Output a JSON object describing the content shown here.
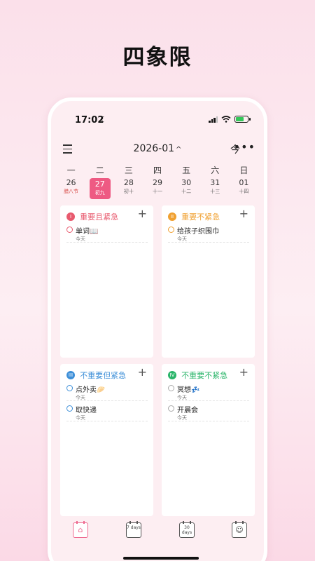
{
  "promo": {
    "title": "四象限"
  },
  "status_bar": {
    "time": "17:02",
    "moon": "☾"
  },
  "colors": {
    "accent": "#ee5a83",
    "q1": "#e85a6e",
    "q2": "#f0a030",
    "q3": "#3d8fd8",
    "q4": "#2bb56a"
  },
  "header": {
    "month": "2026-01",
    "month_chevron": "^",
    "today_label": "今",
    "more_label": "•••"
  },
  "week": {
    "weekdays": [
      "一",
      "二",
      "三",
      "四",
      "五",
      "六",
      "日"
    ],
    "dates": [
      {
        "day": "26",
        "lunar": "腊八节"
      },
      {
        "day": "27",
        "lunar": "初九",
        "selected": true
      },
      {
        "day": "28",
        "lunar": "初十"
      },
      {
        "day": "29",
        "lunar": "十一"
      },
      {
        "day": "30",
        "lunar": "十二"
      },
      {
        "day": "31",
        "lunar": "十三"
      },
      {
        "day": "01",
        "lunar": "十四"
      }
    ]
  },
  "quadrants": [
    {
      "badge": "I",
      "title": "重要且紧急",
      "add": "+",
      "tasks": [
        {
          "text": "单词📖",
          "date": "今天"
        }
      ]
    },
    {
      "badge": "II",
      "title": "重要不紧急",
      "add": "+",
      "tasks": [
        {
          "text": "给孩子织围巾",
          "date": "今天"
        }
      ]
    },
    {
      "badge": "III",
      "title": "不重要但紧急",
      "add": "+",
      "tasks": [
        {
          "text": "点外卖🥟",
          "date": "今天"
        },
        {
          "text": "取快递",
          "date": "今天"
        }
      ]
    },
    {
      "badge": "IV",
      "title": "不重要不紧急",
      "add": "+",
      "tasks": [
        {
          "text": "冥想💤",
          "date": "今天"
        },
        {
          "text": "开晨会",
          "date": "今天"
        }
      ]
    }
  ],
  "tabbar": {
    "tabs": [
      {
        "icon": "home-calendar-icon",
        "label": "⌂"
      },
      {
        "icon": "seven-days-icon",
        "label": "7 days"
      },
      {
        "icon": "thirty-days-icon",
        "label": "30 days"
      },
      {
        "icon": "smile-calendar-icon",
        "label": "☺"
      }
    ]
  }
}
